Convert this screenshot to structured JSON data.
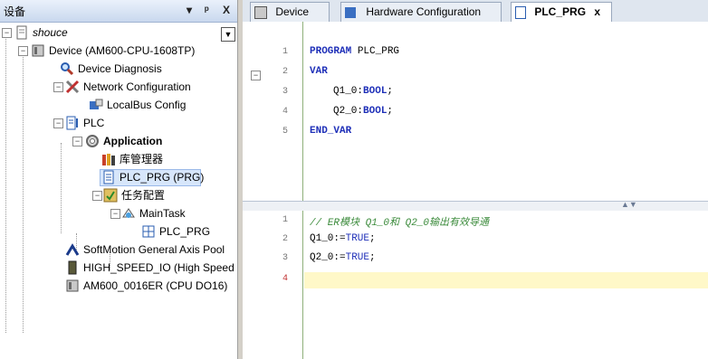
{
  "left_panel": {
    "title": "设备",
    "header_buttons": [
      "▾",
      "ᵖ",
      "X"
    ],
    "tree": [
      {
        "label": "shouce",
        "italic": true,
        "icon": "project-icon"
      },
      {
        "label": "Device (AM600-CPU-1608TP)",
        "icon": "plc-device-icon"
      },
      {
        "label": "Device Diagnosis",
        "icon": "diagnosis-icon"
      },
      {
        "label": "Network Configuration",
        "icon": "network-config-icon"
      },
      {
        "label": "LocalBus Config",
        "icon": "localbus-icon"
      },
      {
        "label": "PLC",
        "icon": "plc-logic-icon"
      },
      {
        "label": "Application",
        "bold": true,
        "icon": "application-icon"
      },
      {
        "label": "库管理器",
        "icon": "library-manager-icon"
      },
      {
        "label": "PLC_PRG (PRG)",
        "icon": "program-icon",
        "selected": true
      },
      {
        "label": "任务配置",
        "icon": "task-config-icon"
      },
      {
        "label": "MainTask",
        "icon": "task-icon"
      },
      {
        "label": "PLC_PRG",
        "icon": "program-call-icon"
      },
      {
        "label": "SoftMotion General Axis Pool",
        "icon": "axis-pool-icon"
      },
      {
        "label": "HIGH_SPEED_IO (High Speed I",
        "icon": "io-module-icon"
      },
      {
        "label": "AM600_0016ER (CPU DO16)",
        "icon": "io-module-icon"
      }
    ]
  },
  "tabs": [
    {
      "label": "Device"
    },
    {
      "label": "Hardware Configuration"
    },
    {
      "label": "PLC_PRG",
      "close": "x",
      "active": true
    }
  ],
  "declaration": {
    "line_numbers": [
      "1",
      "2",
      "3",
      "4",
      "5"
    ],
    "lines": [
      {
        "kw": "PROGRAM",
        "rest": " PLC_PRG"
      },
      {
        "kw": "VAR",
        "rest": ""
      },
      {
        "name": "Q1_0",
        "sep": ":",
        "type": "BOOL",
        "end": ";"
      },
      {
        "name": "Q2_0",
        "sep": ":",
        "type": "BOOL",
        "end": ";"
      },
      {
        "kw": "END_VAR",
        "rest": ""
      }
    ]
  },
  "implementation": {
    "line_numbers": [
      "1",
      "2",
      "3",
      "4"
    ],
    "comment": "// ER模块 Q1_0和 Q2_0输出有效导通",
    "lines": [
      {
        "name": "Q1_0",
        "op": ":=",
        "val": "TRUE",
        "end": ";"
      },
      {
        "name": "Q2_0",
        "op": ":=",
        "val": "TRUE",
        "end": ";"
      }
    ]
  },
  "colors": {
    "keyword": "#1e2fb8",
    "comment": "#3a8a3a",
    "selection": "#d7e6fb"
  }
}
